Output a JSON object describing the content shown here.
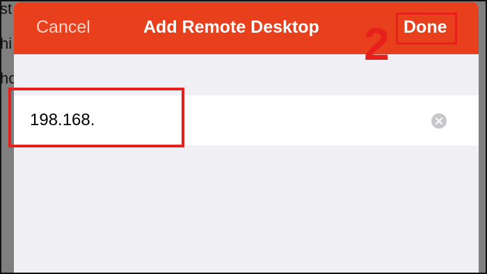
{
  "background": {
    "fragments": [
      "st",
      "hi",
      "ho"
    ]
  },
  "nav": {
    "cancel_label": "Cancel",
    "title": "Add Remote Desktop",
    "done_label": "Done"
  },
  "form": {
    "address_value": "198.168."
  },
  "annotation": {
    "step_number": "2"
  },
  "colors": {
    "nav_background": "#e8401c",
    "highlight": "#e8201c",
    "form_background": "#efeff4"
  },
  "icons": {
    "clear": "clear-circle-icon"
  }
}
